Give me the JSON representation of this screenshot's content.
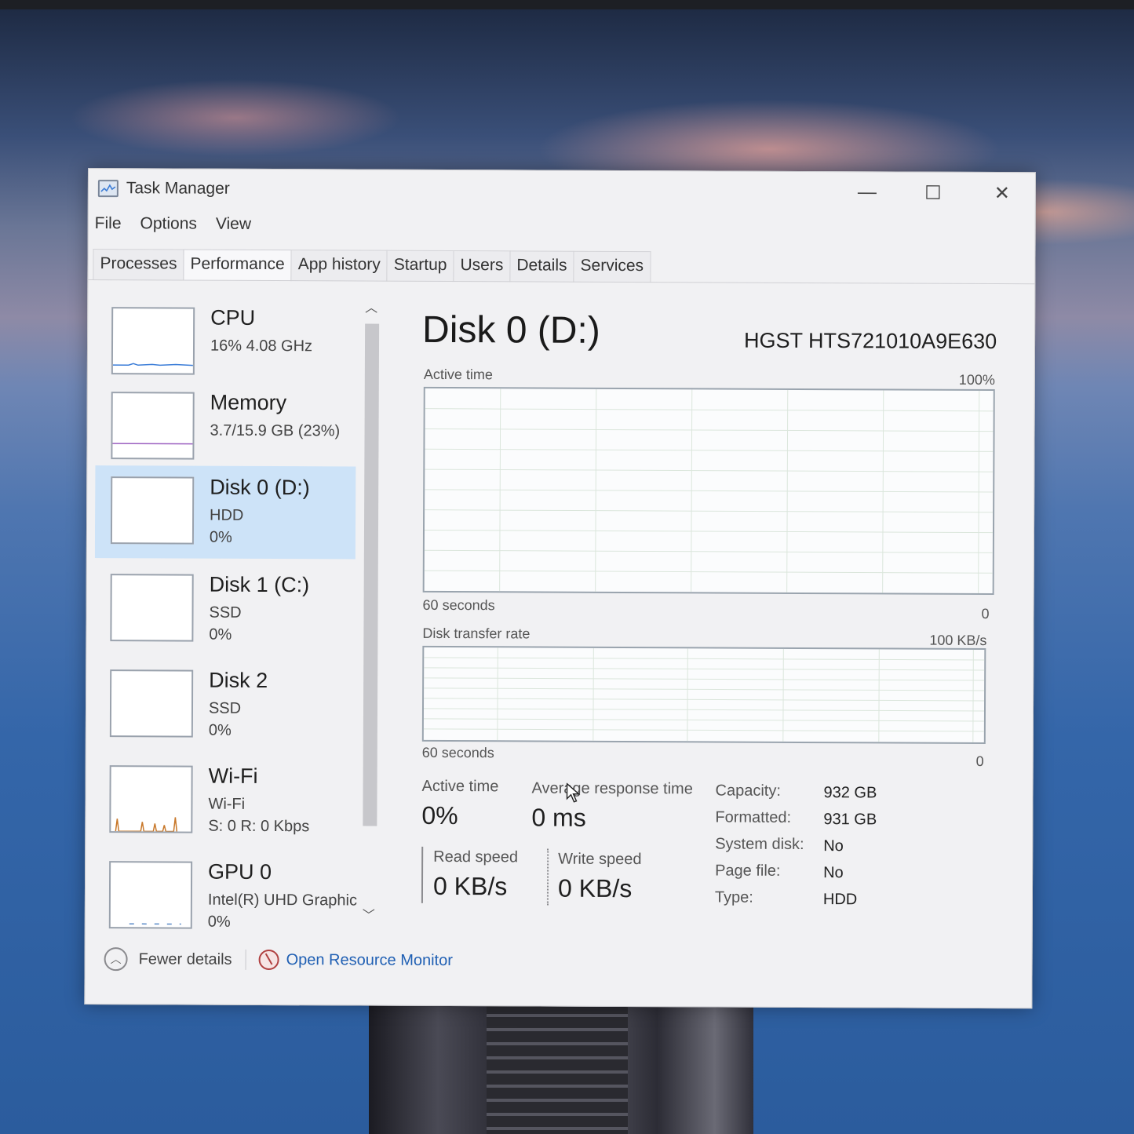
{
  "window": {
    "title": "Task Manager",
    "controls": {
      "minimize": "—",
      "maximize": "☐",
      "close": "✕"
    }
  },
  "menu": [
    "File",
    "Options",
    "View"
  ],
  "tabs": [
    "Processes",
    "Performance",
    "App history",
    "Startup",
    "Users",
    "Details",
    "Services"
  ],
  "active_tab": "Performance",
  "sidebar": {
    "items": [
      {
        "name": "CPU",
        "sub1": "16%  4.08 GHz",
        "sub2": ""
      },
      {
        "name": "Memory",
        "sub1": "3.7/15.9 GB (23%)",
        "sub2": ""
      },
      {
        "name": "Disk 0 (D:)",
        "sub1": "HDD",
        "sub2": "0%"
      },
      {
        "name": "Disk 1 (C:)",
        "sub1": "SSD",
        "sub2": "0%"
      },
      {
        "name": "Disk 2",
        "sub1": "SSD",
        "sub2": "0%"
      },
      {
        "name": "Wi-Fi",
        "sub1": "Wi-Fi",
        "sub2": "S: 0  R: 0 Kbps"
      },
      {
        "name": "GPU 0",
        "sub1": "Intel(R) UHD Graphic",
        "sub2": "0%"
      }
    ],
    "selected_index": 2
  },
  "detail": {
    "title": "Disk 0 (D:)",
    "model": "HGST HTS721010A9E630",
    "active_time_chart": {
      "label": "Active time",
      "max": "100%",
      "time_span": "60 seconds",
      "min": "0"
    },
    "transfer_chart": {
      "label": "Disk transfer rate",
      "max": "100 KB/s",
      "time_span": "60 seconds",
      "min": "0"
    },
    "stats": {
      "active_time_label": "Active time",
      "active_time_value": "0%",
      "avg_response_label": "Average response time",
      "avg_response_value": "0 ms",
      "read_speed_label": "Read speed",
      "read_speed_value": "0 KB/s",
      "write_speed_label": "Write speed",
      "write_speed_value": "0 KB/s"
    },
    "properties": [
      {
        "key": "Capacity:",
        "value": "932 GB"
      },
      {
        "key": "Formatted:",
        "value": "931 GB"
      },
      {
        "key": "System disk:",
        "value": "No"
      },
      {
        "key": "Page file:",
        "value": "No"
      },
      {
        "key": "Type:",
        "value": "HDD"
      }
    ]
  },
  "footer": {
    "fewer_details": "Fewer details",
    "open_resource_monitor": "Open Resource Monitor"
  },
  "colors": {
    "selected_bg": "#cde3f8",
    "link": "#1f5fb3",
    "grid": "#dbe6dc"
  }
}
